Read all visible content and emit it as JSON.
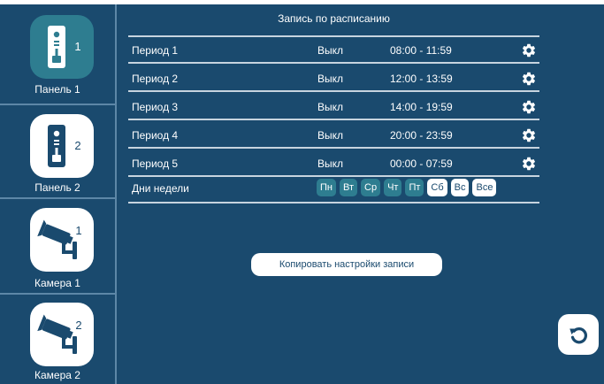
{
  "title": "Запись по расписанию",
  "sidebar": {
    "items": [
      {
        "label": "Панель 1",
        "badge": "1",
        "icon": "doorbell-panel-icon",
        "active": true
      },
      {
        "label": "Панель 2",
        "badge": "2",
        "icon": "doorbell-panel-icon",
        "active": false
      },
      {
        "label": "Камера 1",
        "badge": "1",
        "icon": "security-camera-icon",
        "active": false
      },
      {
        "label": "Камера 2",
        "badge": "2",
        "icon": "security-camera-icon",
        "active": false
      }
    ]
  },
  "periods": [
    {
      "name": "Период 1",
      "state": "Выкл",
      "time": "08:00 - 11:59"
    },
    {
      "name": "Период 2",
      "state": "Выкл",
      "time": "12:00 - 13:59"
    },
    {
      "name": "Период 3",
      "state": "Выкл",
      "time": "14:00 - 19:59"
    },
    {
      "name": "Период 4",
      "state": "Выкл",
      "time": "20:00 - 23:59"
    },
    {
      "name": "Период 5",
      "state": "Выкл",
      "time": "00:00 - 07:59"
    }
  ],
  "weekdays": {
    "label": "Дни недели",
    "days": [
      {
        "label": "Пн",
        "selected": true
      },
      {
        "label": "Вт",
        "selected": true
      },
      {
        "label": "Ср",
        "selected": true
      },
      {
        "label": "Чт",
        "selected": true
      },
      {
        "label": "Пт",
        "selected": true
      },
      {
        "label": "Сб",
        "selected": false
      },
      {
        "label": "Вс",
        "selected": false
      },
      {
        "label": "Все",
        "selected": false
      }
    ]
  },
  "copy_button": "Копировать настройки записи",
  "back_icon": "back-arrow-icon",
  "colors": {
    "background": "#1a4a6e",
    "accent": "#2e7d90",
    "divider": "#c7d4df"
  }
}
